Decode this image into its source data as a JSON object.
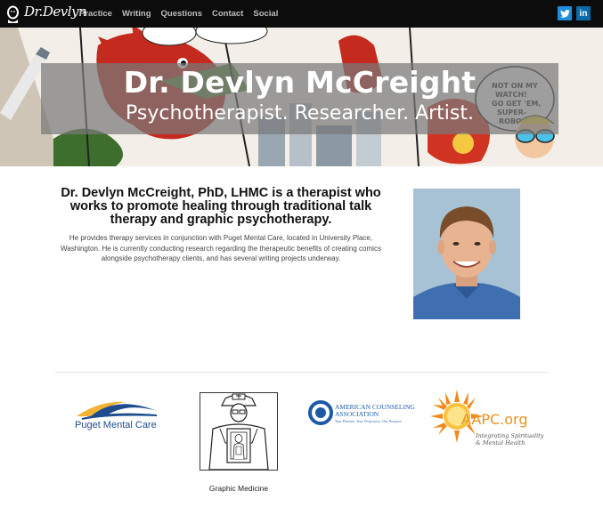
{
  "nav": {
    "brand_signature": "Dr.Devlyn",
    "links": [
      "Practice",
      "Writing",
      "Questions",
      "Contact",
      "Social"
    ],
    "social": [
      {
        "name": "twitter-icon",
        "glyph": "t",
        "color": "#1d8ddc"
      },
      {
        "name": "linkedin-icon",
        "glyph": "in",
        "color": "#0c6aa8"
      }
    ]
  },
  "hero": {
    "title": "Dr. Devlyn McCreight",
    "subtitle": "Psychotherapist. Researcher. Artist."
  },
  "intro": {
    "heading": "Dr. Devlyn McCreight, PhD, LHMC is a therapist who works to promote healing through traditional talk therapy and graphic psychotherapy.",
    "body": "He provides therapy services in conjunction with Puget Mental Care, located in University Place, Washington. He is currently conducting research regarding the therapeutic benefits of creating comics alongside psychotherapy clients, and has several writing projects underway."
  },
  "logos": {
    "pmc": {
      "name": "Puget Mental Care"
    },
    "graphic_medicine": {
      "caption": "Graphic Medicine"
    },
    "aca": {
      "line1": "AMERICAN COUNSELING",
      "line2": "ASSOCIATION",
      "tagline": "Your Passion. Your Profession. Our Purpose."
    },
    "aapc": {
      "name": "AAPC.org",
      "tagline1": "Integrating Spirituality",
      "tagline2": "& Mental Health"
    }
  },
  "colors": {
    "navbar": "#0c0c0c",
    "nav_link": "#bdbdbd",
    "twitter": "#1d8ddc",
    "linkedin": "#0c6aa8",
    "pmc_blue": "#1d4c8e",
    "aapc_orange": "#e79320"
  }
}
